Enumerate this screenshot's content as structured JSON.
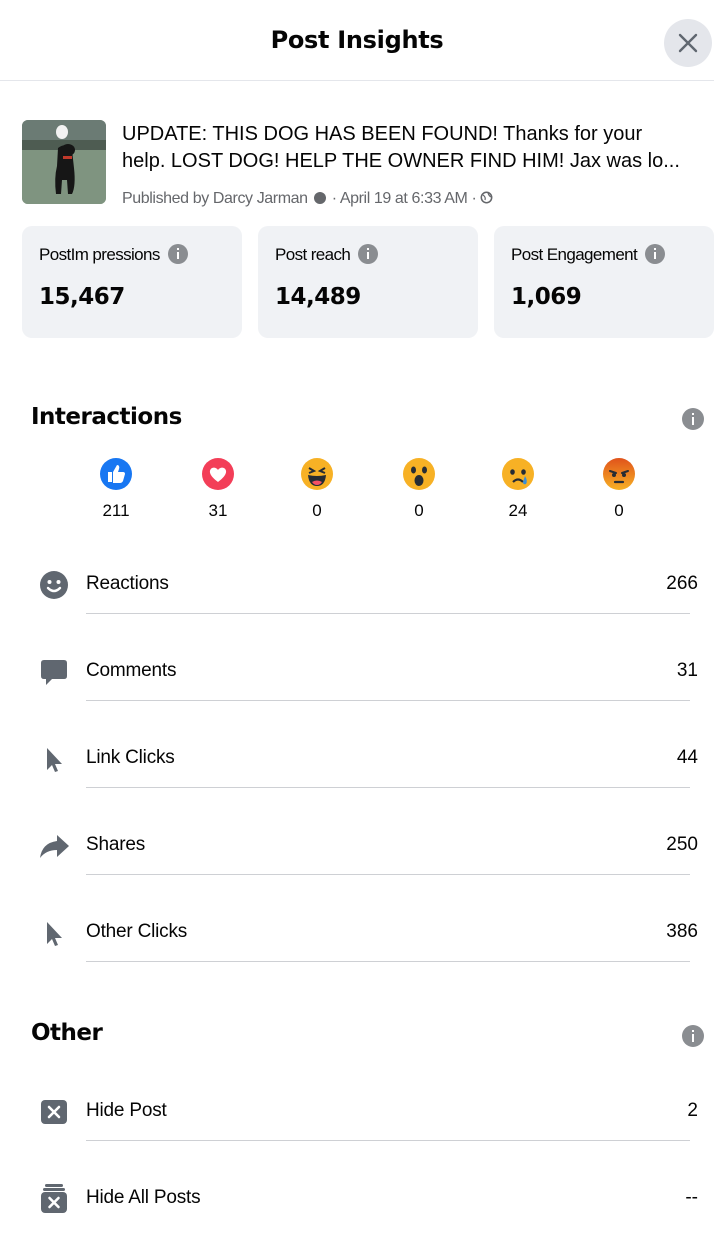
{
  "header": {
    "title": "Post Insights",
    "close_icon": "close-icon"
  },
  "post": {
    "line1": "UPDATE: THIS DOG HAS BEEN FOUND! Thanks for your",
    "line2": "help. LOST DOG! HELP THE OWNER FIND HIM! Jax was lo...",
    "published_by": "Published by Darcy Jarman",
    "date": "· April 19 at 6:33 AM ·",
    "audience_icon": "globe-icon"
  },
  "cards": [
    {
      "label": "PostIm pressions",
      "value": "15,467"
    },
    {
      "label": "Post reach",
      "value": "14,489"
    },
    {
      "label": "Post Engagement",
      "value": "1,069"
    }
  ],
  "interactions": {
    "title": "Interactions",
    "reactions": [
      {
        "icon": "like-icon",
        "count": "211",
        "color": "#1877f2"
      },
      {
        "icon": "love-icon",
        "count": "31",
        "color": "#f33e58"
      },
      {
        "icon": "haha-icon",
        "count": "0",
        "color": "#f7b125"
      },
      {
        "icon": "wow-icon",
        "count": "0",
        "color": "#f7b125"
      },
      {
        "icon": "sad-icon",
        "count": "24",
        "color": "#f7b125"
      },
      {
        "icon": "angry-icon",
        "count": "0",
        "color": "#e9710f"
      }
    ],
    "metrics": [
      {
        "icon": "smiley-icon",
        "label": "Reactions",
        "value": "266"
      },
      {
        "icon": "comment-icon",
        "label": "Comments",
        "value": "31"
      },
      {
        "icon": "cursor-icon",
        "label": "Link Clicks",
        "value": "44"
      },
      {
        "icon": "share-icon",
        "label": "Shares",
        "value": "250"
      },
      {
        "icon": "cursor-icon",
        "label": "Other Clicks",
        "value": "386"
      }
    ]
  },
  "other": {
    "title": "Other",
    "metrics": [
      {
        "icon": "hide-post-icon",
        "label": "Hide Post",
        "value": "2"
      },
      {
        "icon": "hide-all-posts-icon",
        "label": "Hide All Posts",
        "value": "--"
      }
    ]
  }
}
